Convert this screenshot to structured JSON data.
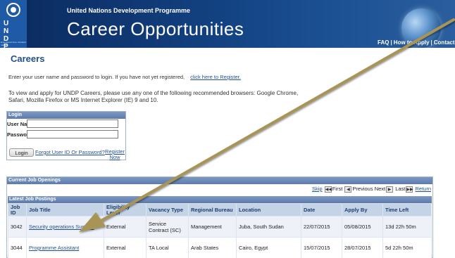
{
  "header": {
    "logo_letters": "U N D P",
    "logo_tagline": "Empowered lives. Resilient nations.",
    "org_name": "United Nations Development Programme",
    "site_title": "Career Opportunities",
    "top_links": [
      "FAQ",
      "How to Apply",
      "Contact"
    ]
  },
  "page": {
    "title": "Careers",
    "intro_text": "Enter your user name and password to login. If you have not yet registered,",
    "register_link": "click here to Register.",
    "browsers_text": "To view and apply for UNDP Careers, please use any one of the following recommended browsers: Google Chrome, Safari, Mozilla Firefox or MS Internet Explorer (IE) 9 and 10."
  },
  "login": {
    "header": "Login",
    "username_label": "User Name:",
    "password_label": "Password:",
    "username_value": "",
    "password_value": "",
    "login_button": "Login",
    "forgot_link": "Forgot User ID Or Password?",
    "register_now": "Register Now"
  },
  "jobs": {
    "panel_header": "Current Job Openings",
    "pager": {
      "skip": "Skip",
      "first": "First",
      "previous": "Previous",
      "next": "Next",
      "last": "Last",
      "return": "Return"
    },
    "section_header": "Latest Job Postings",
    "columns": [
      "Job ID",
      "Job Title",
      "Eligibility Level",
      "Vacancy Type",
      "Regional Bureau",
      "Location",
      "Date",
      "Apply By",
      "Time Left"
    ],
    "rows": [
      {
        "job_id": "3042",
        "title": "Security operations Support",
        "eligibility": "External",
        "vacancy_type": "Service Contract (SC)",
        "bureau": "Management",
        "location": "Juba, South Sudan",
        "date": "22/07/2015",
        "apply_by": "05/08/2015",
        "time_left": "13d 22h 50m"
      },
      {
        "job_id": "3044",
        "title": "Programme Assistant",
        "eligibility": "External",
        "vacancy_type": "TA Local",
        "bureau": "Arab States",
        "location": "Cairo, Egypt",
        "date": "15/07/2015",
        "apply_by": "28/07/2015",
        "time_left": "5d 22h 50m"
      }
    ]
  },
  "colors": {
    "header_dark": "#0a2a5e",
    "link_blue": "#1f4f8f",
    "panel_header": "#5d7bab",
    "column_header_bg": "#c5d3e6",
    "arrow": "#a89454"
  }
}
